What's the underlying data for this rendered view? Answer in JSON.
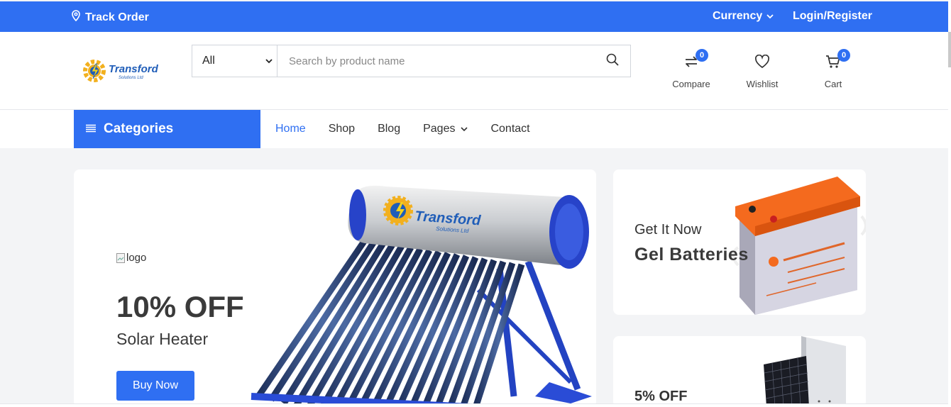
{
  "topbar": {
    "track_order": "Track Order",
    "currency": "Currency",
    "login": "Login/Register"
  },
  "logo": {
    "brand": "Transford",
    "sub": "Solutions Ltd"
  },
  "search": {
    "category": "All",
    "placeholder": "Search by product name"
  },
  "header_icons": {
    "compare": {
      "label": "Compare",
      "count": "0"
    },
    "wishlist": {
      "label": "Wishlist"
    },
    "cart": {
      "label": "Cart",
      "count": "0"
    }
  },
  "navbar": {
    "categories": "Categories",
    "links": [
      "Home",
      "Shop",
      "Blog",
      "Pages",
      "Contact"
    ]
  },
  "hero": {
    "img_alt": "logo",
    "headline": "10% OFF",
    "product": "Solar Heater",
    "button": "Buy Now",
    "heater_brand": "Transford",
    "heater_sub": "Solutions Ltd"
  },
  "side_banner_1": {
    "line1": "Get It Now",
    "line2": "Gel Batteries"
  },
  "side_banner_2": {
    "line1": "5% OFF"
  },
  "colors": {
    "accent": "#2f6ff2",
    "battery_lid": "#f46a1e"
  }
}
